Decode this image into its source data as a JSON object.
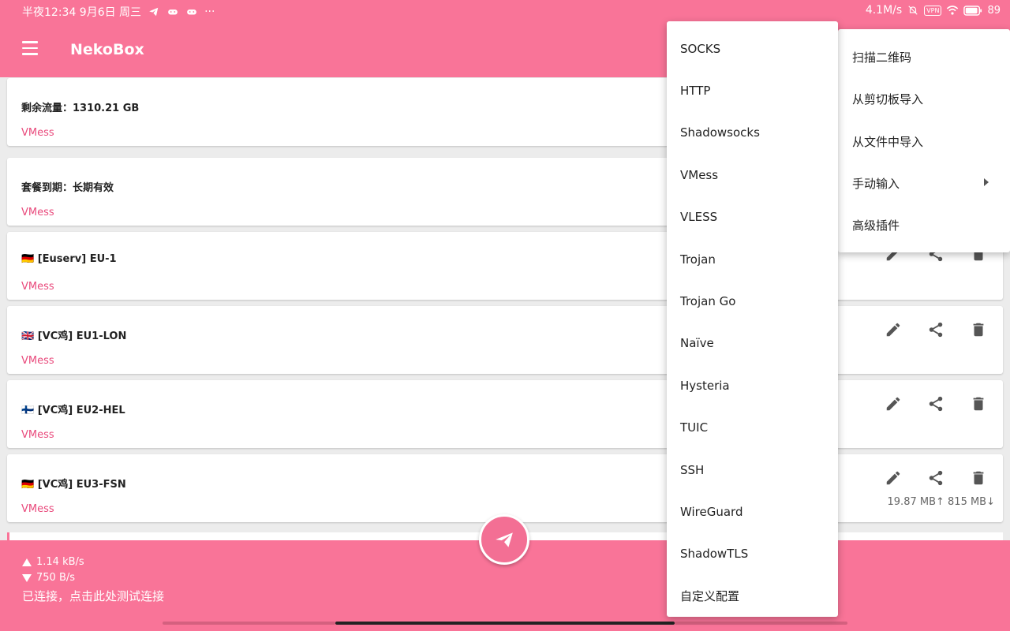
{
  "status_bar": {
    "time_date": "半夜12:34 9月6日 周三",
    "more": "···",
    "net_speed": "4.1M/s",
    "vpn": "VPN",
    "battery": "89"
  },
  "app": {
    "title": "NekoBox"
  },
  "cards": [
    {
      "title": "剩余流量：1310.21 GB",
      "type": "VMess"
    },
    {
      "title": "套餐到期：长期有效",
      "type": "VMess"
    },
    {
      "flag": "🇩🇪",
      "title": "[Euserv] EU-1",
      "type": "VMess"
    },
    {
      "flag": "🇬🇧",
      "title": "[VC鸡] EU1-LON",
      "type": "VMess"
    },
    {
      "flag": "🇫🇮",
      "title": "[VC鸡] EU2-HEL",
      "type": "VMess"
    },
    {
      "flag": "🇩🇪",
      "title": "[VC鸡] EU3-FSN",
      "type": "VMess",
      "traffic": "19.87 MB↑ 815 MB↓"
    }
  ],
  "bottom": {
    "upload": "1.14 kB/s",
    "download": "750 B/s",
    "connection": "已连接，点击此处测试连接"
  },
  "main_menu": {
    "items": [
      "扫描二维码",
      "从剪切板导入",
      "从文件中导入",
      "手动输入",
      "高级插件"
    ]
  },
  "sub_menu": {
    "items": [
      "SOCKS",
      "HTTP",
      "Shadowsocks",
      "VMess",
      "VLESS",
      "Trojan",
      "Trojan Go",
      "Naïve",
      "Hysteria",
      "TUIC",
      "SSH",
      "WireGuard",
      "ShadowTLS",
      "自定义配置"
    ]
  },
  "colors": {
    "primary": "#f97498",
    "accent_text": "#e94a7c"
  }
}
